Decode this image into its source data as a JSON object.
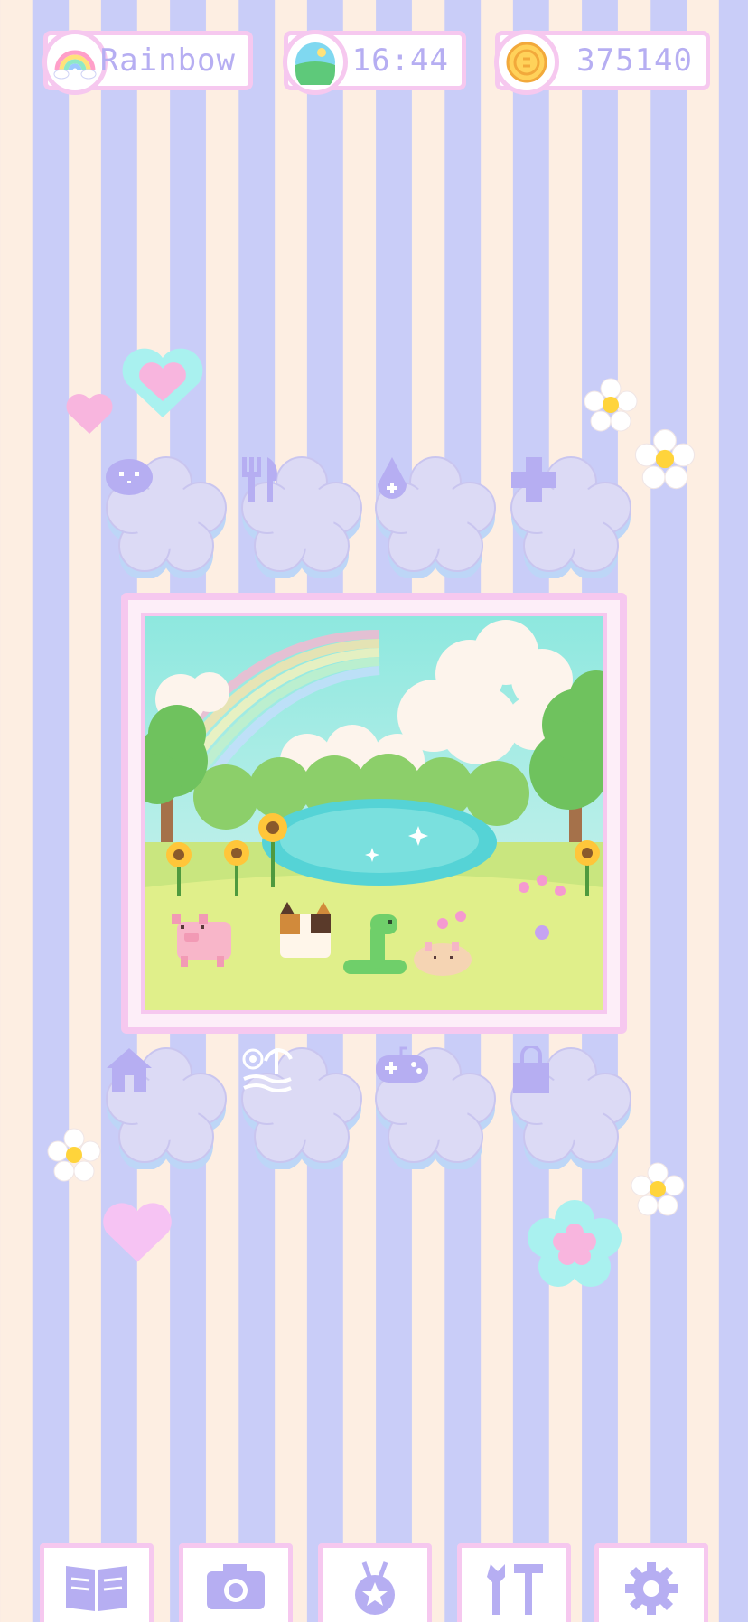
{
  "status_bar": {
    "weather_label": "Rainbow",
    "time": "16:44",
    "coins": "375140"
  },
  "top_actions": [
    {
      "icon": "pet-face-icon"
    },
    {
      "icon": "fork-knife-icon"
    },
    {
      "icon": "water-drop-icon"
    },
    {
      "icon": "plus-icon"
    }
  ],
  "bottom_actions": [
    {
      "icon": "house-icon"
    },
    {
      "icon": "beach-icon"
    },
    {
      "icon": "gamepad-icon"
    },
    {
      "icon": "shopping-bag-icon"
    }
  ],
  "nav": [
    {
      "icon": "book-icon"
    },
    {
      "icon": "camera-icon"
    },
    {
      "icon": "medal-icon"
    },
    {
      "icon": "tools-icon"
    },
    {
      "icon": "settings-gear-icon"
    }
  ],
  "colors": {
    "stripe_light": "#fdeee2",
    "stripe_lavender": "#c9cdf8",
    "pink_border": "#f6c8ef",
    "icon_purple": "#b6aef2",
    "flower_fill": "#dcdaf5"
  }
}
